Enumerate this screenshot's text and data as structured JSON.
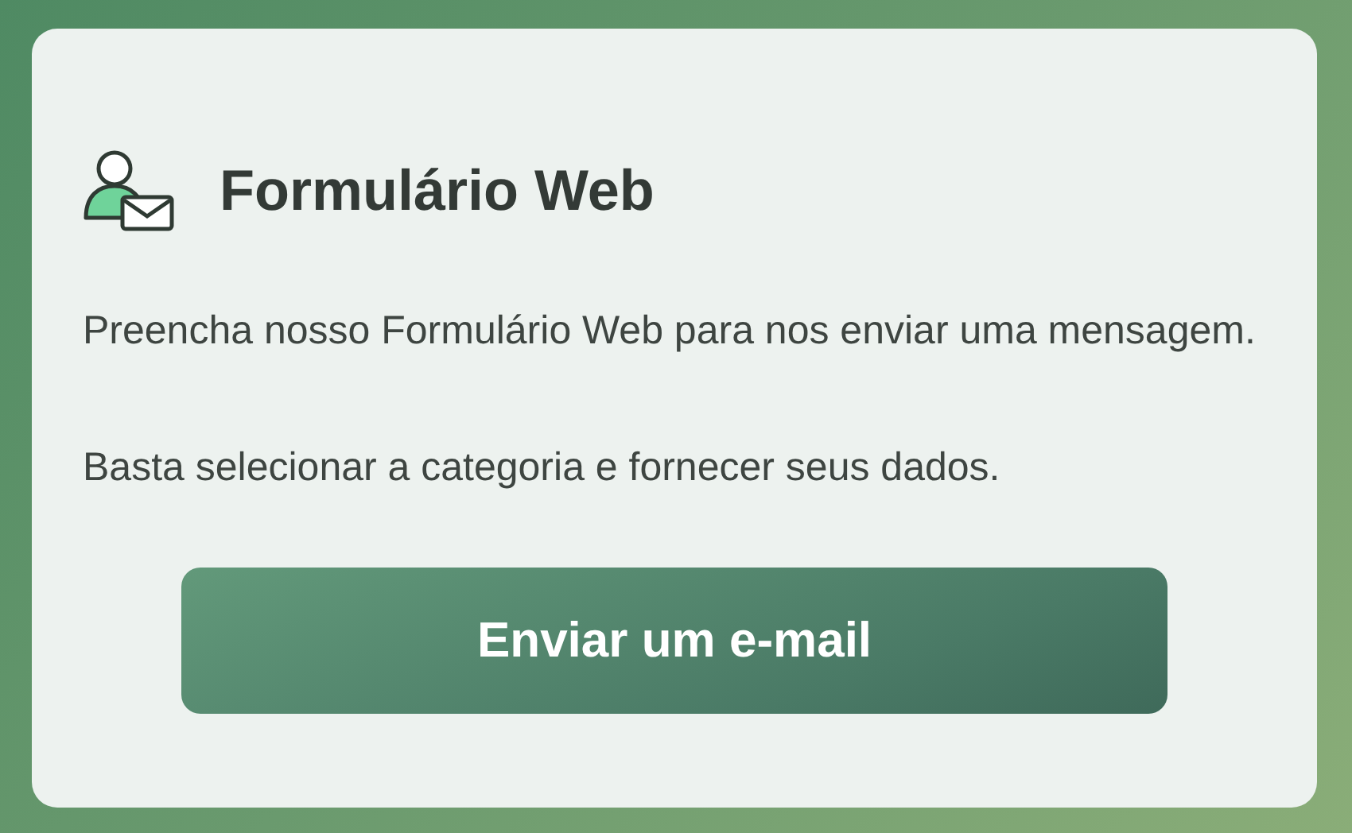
{
  "card": {
    "title": "Formulário Web",
    "paragraphs": [
      "Preencha nosso Formulário Web para nos enviar uma mensagem.",
      "Basta selecionar a categoria e fornecer seus dados."
    ],
    "button": "Enviar um e-mail"
  }
}
